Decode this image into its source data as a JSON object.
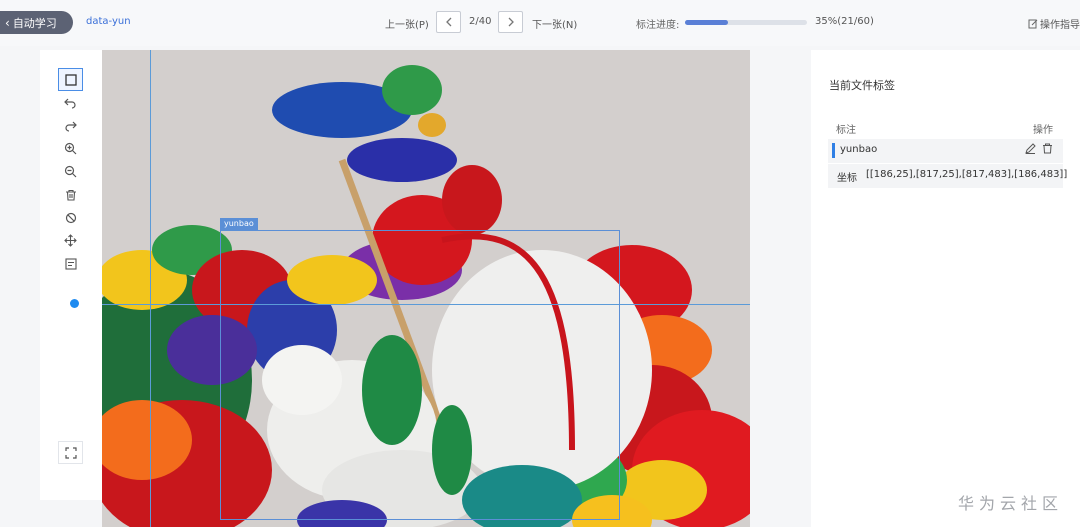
{
  "topbar": {
    "back_label": "自动学习",
    "dataset_name": "data-yun",
    "prev_label": "上一张(P)",
    "page_count": "2/40",
    "next_label": "下一张(N)",
    "progress_label": "标注进度:",
    "progress_percent": 35,
    "progress_text": "35%(21/60)",
    "guide_label": "操作指导"
  },
  "tools": [
    "rectangle-tool",
    "undo",
    "redo",
    "zoom-in",
    "zoom-out",
    "delete",
    "hide",
    "move",
    "list"
  ],
  "canvas": {
    "bbox_label": "yunbao"
  },
  "right_panel": {
    "title": "当前文件标签",
    "col_label": "标注",
    "col_op": "操作",
    "annotation": {
      "name": "yunbao",
      "coord_label": "坐标",
      "coords": "[[186,25],[817,25],[817,483],[186,483]]"
    }
  },
  "watermark": "华为云社区",
  "colors": {
    "accent": "#2f7fe5",
    "back_button": "#5c6274",
    "bbox": "#5b8fd6"
  }
}
